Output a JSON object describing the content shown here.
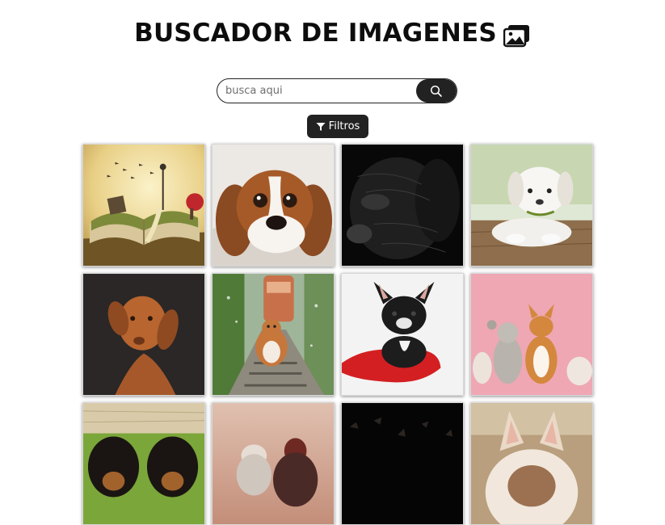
{
  "header": {
    "title": "BUSCADOR DE IMAGENES",
    "icon": "images-icon"
  },
  "search": {
    "placeholder": "busca aqui",
    "value": "",
    "button_icon": "search-icon"
  },
  "filters": {
    "label": "Filtros",
    "icon": "funnel-icon"
  },
  "colors": {
    "accent": "#222222",
    "background": "#ffffff"
  },
  "gallery": {
    "columns": 4,
    "visible_images": 12
  }
}
